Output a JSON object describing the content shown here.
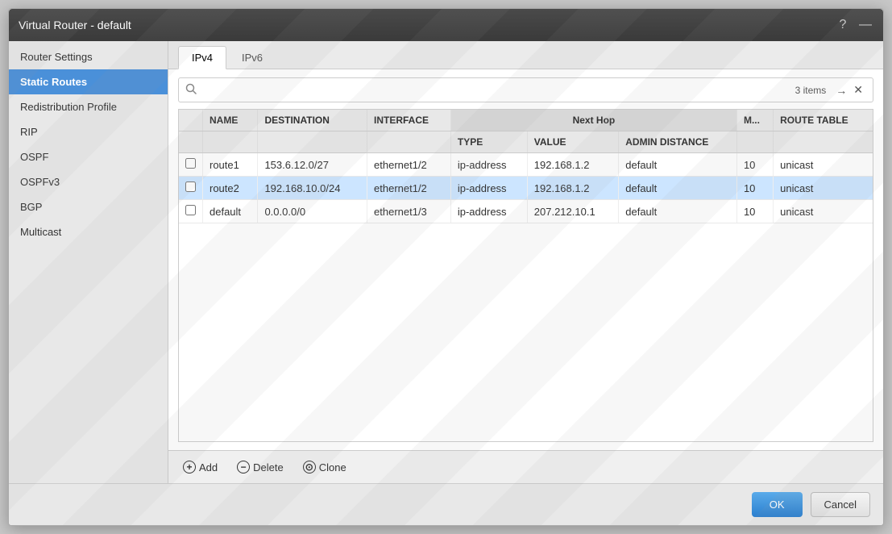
{
  "dialog": {
    "title": "Virtual Router - default",
    "help_icon": "?",
    "minimize_icon": "—"
  },
  "sidebar": {
    "items": [
      {
        "id": "router-settings",
        "label": "Router Settings",
        "active": false
      },
      {
        "id": "static-routes",
        "label": "Static Routes",
        "active": true
      },
      {
        "id": "redistribution-profile",
        "label": "Redistribution Profile",
        "active": false
      },
      {
        "id": "rip",
        "label": "RIP",
        "active": false
      },
      {
        "id": "ospf",
        "label": "OSPF",
        "active": false
      },
      {
        "id": "ospfv3",
        "label": "OSPFv3",
        "active": false
      },
      {
        "id": "bgp",
        "label": "BGP",
        "active": false
      },
      {
        "id": "multicast",
        "label": "Multicast",
        "active": false
      }
    ]
  },
  "tabs": [
    {
      "id": "ipv4",
      "label": "IPv4",
      "active": true
    },
    {
      "id": "ipv6",
      "label": "IPv6",
      "active": false
    }
  ],
  "search": {
    "placeholder": "",
    "count": "3 items"
  },
  "table": {
    "next_hop_header": "Next Hop",
    "columns": [
      {
        "key": "checkbox",
        "label": ""
      },
      {
        "key": "name",
        "label": "NAME"
      },
      {
        "key": "destination",
        "label": "DESTINATION"
      },
      {
        "key": "interface",
        "label": "INTERFACE"
      },
      {
        "key": "type",
        "label": "TYPE"
      },
      {
        "key": "value",
        "label": "VALUE"
      },
      {
        "key": "admin_distance",
        "label": "ADMIN DISTANCE"
      },
      {
        "key": "m",
        "label": "M..."
      },
      {
        "key": "route_table",
        "label": "ROUTE TABLE"
      }
    ],
    "rows": [
      {
        "name": "route1",
        "destination": "153.6.12.0/27",
        "interface": "ethernet1/2",
        "type": "ip-address",
        "value": "192.168.1.2",
        "admin_distance": "default",
        "m": "10",
        "route_table": "unicast",
        "highlighted": false
      },
      {
        "name": "route2",
        "destination": "192.168.10.0/24",
        "interface": "ethernet1/2",
        "type": "ip-address",
        "value": "192.168.1.2",
        "admin_distance": "default",
        "m": "10",
        "route_table": "unicast",
        "highlighted": true
      },
      {
        "name": "default",
        "destination": "0.0.0.0/0",
        "interface": "ethernet1/3",
        "type": "ip-address",
        "value": "207.212.10.1",
        "admin_distance": "default",
        "m": "10",
        "route_table": "unicast",
        "highlighted": false
      }
    ]
  },
  "toolbar": {
    "add_label": "Add",
    "delete_label": "Delete",
    "clone_label": "Clone"
  },
  "footer": {
    "ok_label": "OK",
    "cancel_label": "Cancel"
  }
}
